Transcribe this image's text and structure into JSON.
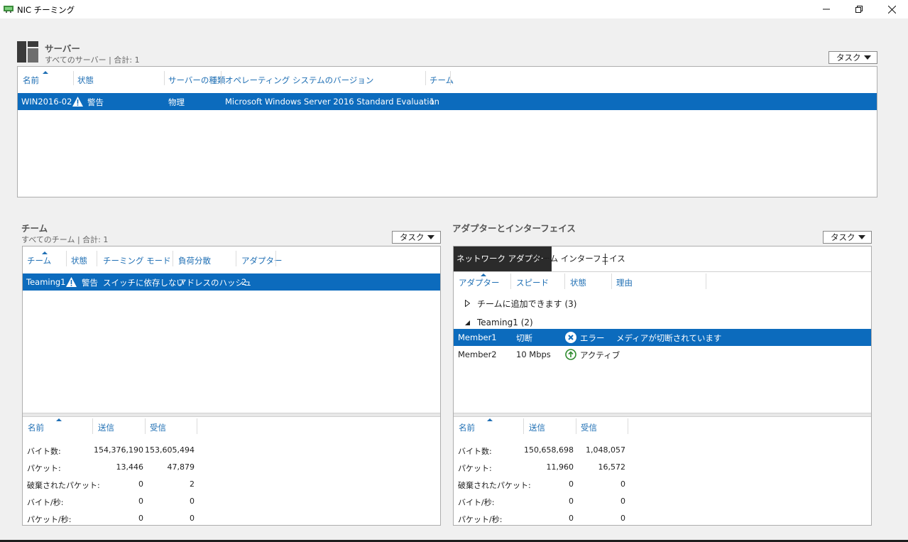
{
  "window": {
    "title": "NIC チーミング"
  },
  "servers": {
    "title": "サーバー",
    "subtitle": "すべてのサーバー | 合計: 1",
    "task_label": "タスク",
    "columns": [
      "名前",
      "状態",
      "サーバーの種類",
      "オペレーティング システムのバージョン",
      "チーム"
    ],
    "rows": [
      {
        "name": "WIN2016-02",
        "status": "警告",
        "type": "物理",
        "os": "Microsoft Windows Server 2016 Standard Evaluation",
        "teams": "1"
      }
    ]
  },
  "teams": {
    "title": "チーム",
    "subtitle": "すべてのチーム | 合計: 1",
    "task_label": "タスク",
    "columns": [
      "チーム",
      "状態",
      "チーミング モード",
      "負荷分散",
      "アダプター"
    ],
    "rows": [
      {
        "team": "Teaming1",
        "status": "警告",
        "mode": "スイッチに依存しない",
        "lb": "アドレスのハッシュ",
        "adapters": "2"
      }
    ],
    "stats": {
      "columns": [
        "名前",
        "送信",
        "受信"
      ],
      "rows": [
        {
          "label": "バイト数:",
          "sent": "154,376,190",
          "recv": "153,605,494"
        },
        {
          "label": "パケット:",
          "sent": "13,446",
          "recv": "47,879"
        },
        {
          "label": "破棄されたパケット:",
          "sent": "0",
          "recv": "2"
        },
        {
          "label": "バイト/秒:",
          "sent": "0",
          "recv": "0"
        },
        {
          "label": "パケット/秒:",
          "sent": "0",
          "recv": "0"
        }
      ]
    }
  },
  "adapters": {
    "title": "アダプターとインターフェイス",
    "task_label": "タスク",
    "tabs": [
      "ネットワーク アダプター",
      "チーム インターフェイス"
    ],
    "active_tab": 0,
    "columns": [
      "アダプター",
      "スピード",
      "状態",
      "理由"
    ],
    "groups": [
      {
        "label": "チームに追加できます (3)",
        "expanded": false
      },
      {
        "label": "Teaming1 (2)",
        "expanded": true
      }
    ],
    "rows": [
      {
        "name": "Member1",
        "speed": "切断",
        "status": "エラー",
        "reason": "メディアが切断されています",
        "status_icon": "error-icon"
      },
      {
        "name": "Member2",
        "speed": "10 Mbps",
        "status": "アクティブ",
        "reason": "",
        "status_icon": "active-up-icon"
      }
    ],
    "stats": {
      "columns": [
        "名前",
        "送信",
        "受信"
      ],
      "rows": [
        {
          "label": "バイト数:",
          "sent": "150,658,698",
          "recv": "1,048,057"
        },
        {
          "label": "パケット:",
          "sent": "11,960",
          "recv": "16,572"
        },
        {
          "label": "破棄されたパケット:",
          "sent": "0",
          "recv": "0"
        },
        {
          "label": "バイト/秒:",
          "sent": "0",
          "recv": "0"
        },
        {
          "label": "パケット/秒:",
          "sent": "0",
          "recv": "0"
        }
      ]
    }
  },
  "colors": {
    "selection": "#0c6bbd",
    "header_text": "#1f6fb4",
    "active_green": "#2e8b2e"
  }
}
